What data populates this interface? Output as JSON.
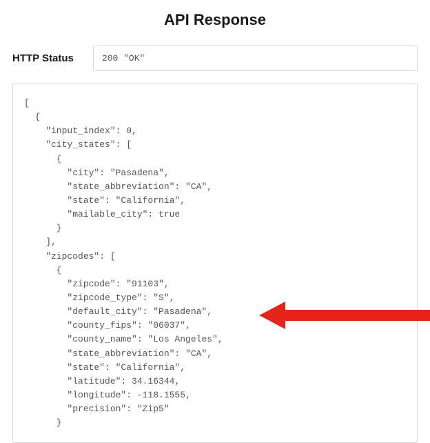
{
  "title": "API Response",
  "status": {
    "label": "HTTP Status",
    "value": "200 \"OK\""
  },
  "response_lines": [
    "[",
    "  {",
    "    \"input_index\": 0,",
    "    \"city_states\": [",
    "      {",
    "        \"city\": \"Pasadena\",",
    "        \"state_abbreviation\": \"CA\",",
    "        \"state\": \"California\",",
    "        \"mailable_city\": true",
    "      }",
    "    ],",
    "    \"zipcodes\": [",
    "      {",
    "        \"zipcode\": \"91103\",",
    "        \"zipcode_type\": \"S\",",
    "        \"default_city\": \"Pasadena\",",
    "        \"county_fips\": \"06037\",",
    "        \"county_name\": \"Los Angeles\",",
    "        \"state_abbreviation\": \"CA\",",
    "        \"state\": \"California\",",
    "        \"latitude\": 34.16344,",
    "        \"longitude\": -118.1555,",
    "        \"precision\": \"Zip5\"",
    "      }"
  ],
  "response_data": {
    "input_index": 0,
    "city_states": [
      {
        "city": "Pasadena",
        "state_abbreviation": "CA",
        "state": "California",
        "mailable_city": true
      }
    ],
    "zipcodes": [
      {
        "zipcode": "91103",
        "zipcode_type": "S",
        "default_city": "Pasadena",
        "county_fips": "06037",
        "county_name": "Los Angeles",
        "state_abbreviation": "CA",
        "state": "California",
        "latitude": 34.16344,
        "longitude": -118.1555,
        "precision": "Zip5"
      }
    ]
  },
  "annotation": {
    "arrow_color": "#e8241a",
    "target_line": "county_name"
  }
}
